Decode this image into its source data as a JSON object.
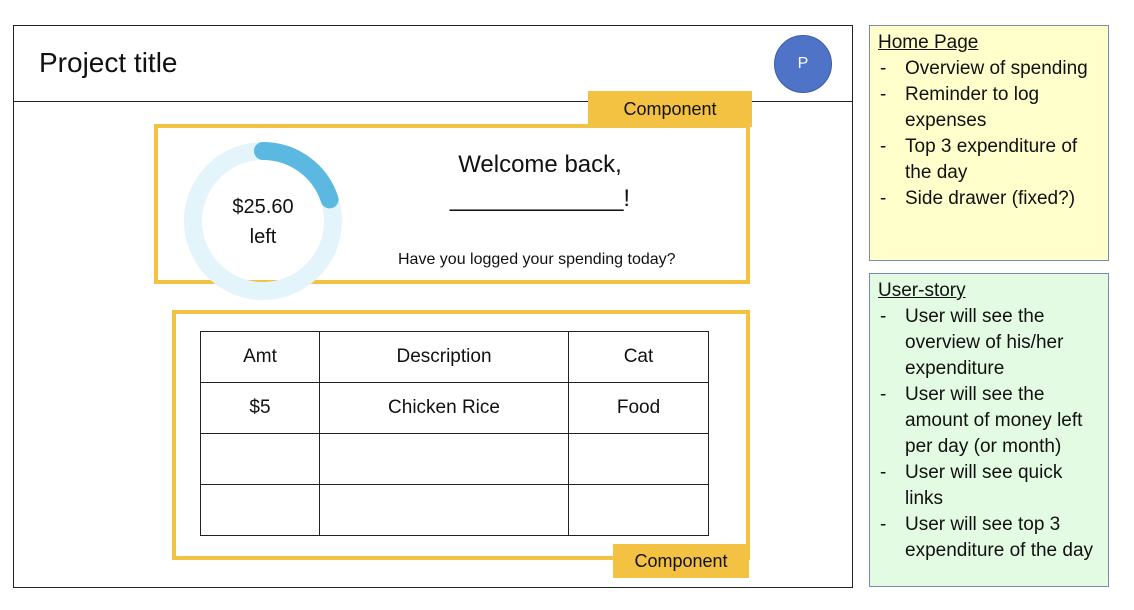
{
  "header": {
    "project_title": "Project title",
    "avatar_initial": "P",
    "avatar_color": "#4f73c7"
  },
  "component_label": "Component",
  "accent_color": "#f4c242",
  "welcome_card": {
    "budget_amount": "$25.60",
    "budget_suffix": "left",
    "progress_fraction": 0.2,
    "progress_color": "#5bb8e0",
    "track_color": "#e4f4fb",
    "greeting": "Welcome back,",
    "name_blank": "_____________!",
    "reminder": "Have you logged your spending today?"
  },
  "expenses_table": {
    "headers": [
      "Amt",
      "Description",
      "Cat"
    ],
    "rows": [
      [
        "$5",
        "Chicken Rice",
        "Food"
      ],
      [
        "",
        "",
        ""
      ],
      [
        "",
        "",
        ""
      ]
    ]
  },
  "notes": {
    "home_page": {
      "title": "Home Page",
      "items": [
        "Overview of spending",
        "Reminder to log expenses",
        "Top 3 expenditure of the day",
        "Side drawer (fixed?)"
      ]
    },
    "user_story": {
      "title": "User-story",
      "items": [
        "User will see the overview of his/her expenditure",
        "User will see the amount of money left per day (or month)",
        "User will see quick links",
        "User will see top 3 expenditure of the day"
      ]
    }
  }
}
